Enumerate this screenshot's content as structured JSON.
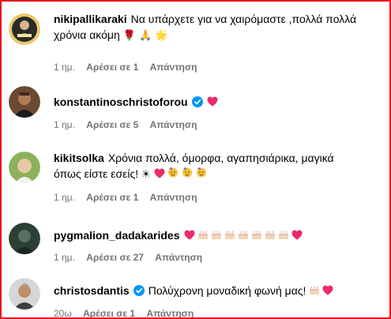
{
  "comments": [
    {
      "username": "nikipallikaraki",
      "text_line1": "Να υπάρχετε για να χαιρόμαστε ,πολλά πολλά",
      "text_line2": "χρόνια ακόμη",
      "emojis": "🌹 🙏 🌟",
      "time": "1 ημ.",
      "likes": "Αρέσει σε 1",
      "reply": "Απάντηση"
    },
    {
      "username": "konstantinoschristoforou",
      "verified": true,
      "time": "1 ημ.",
      "likes": "Αρέσει σε 5",
      "reply": "Απάντηση"
    },
    {
      "username": "kikitsolka",
      "text_line1": "Χρόνια πολλά, όμορφα, αγαπησιάρικα, μαγικά",
      "text_line2": "όπως είστε εσείς!",
      "time": "1 ημ.",
      "likes": "Αρέσει σε 1",
      "reply": "Απάντηση"
    },
    {
      "username": "pygmalion_dadakarides",
      "time": "1 ημ.",
      "likes": "Αρέσει σε 27",
      "reply": "Απάντηση"
    },
    {
      "username": "christosdantis",
      "verified": true,
      "text": "Πολύχρονη μοναδική φωνή μας!",
      "time": "20ω",
      "likes": "Αρέσει σε 1",
      "reply": "Απάντηση"
    }
  ],
  "colors": {
    "verified": "#0095f6",
    "heart": "#ed2a6b",
    "meta": "#737373",
    "frame": "#e8151f"
  }
}
